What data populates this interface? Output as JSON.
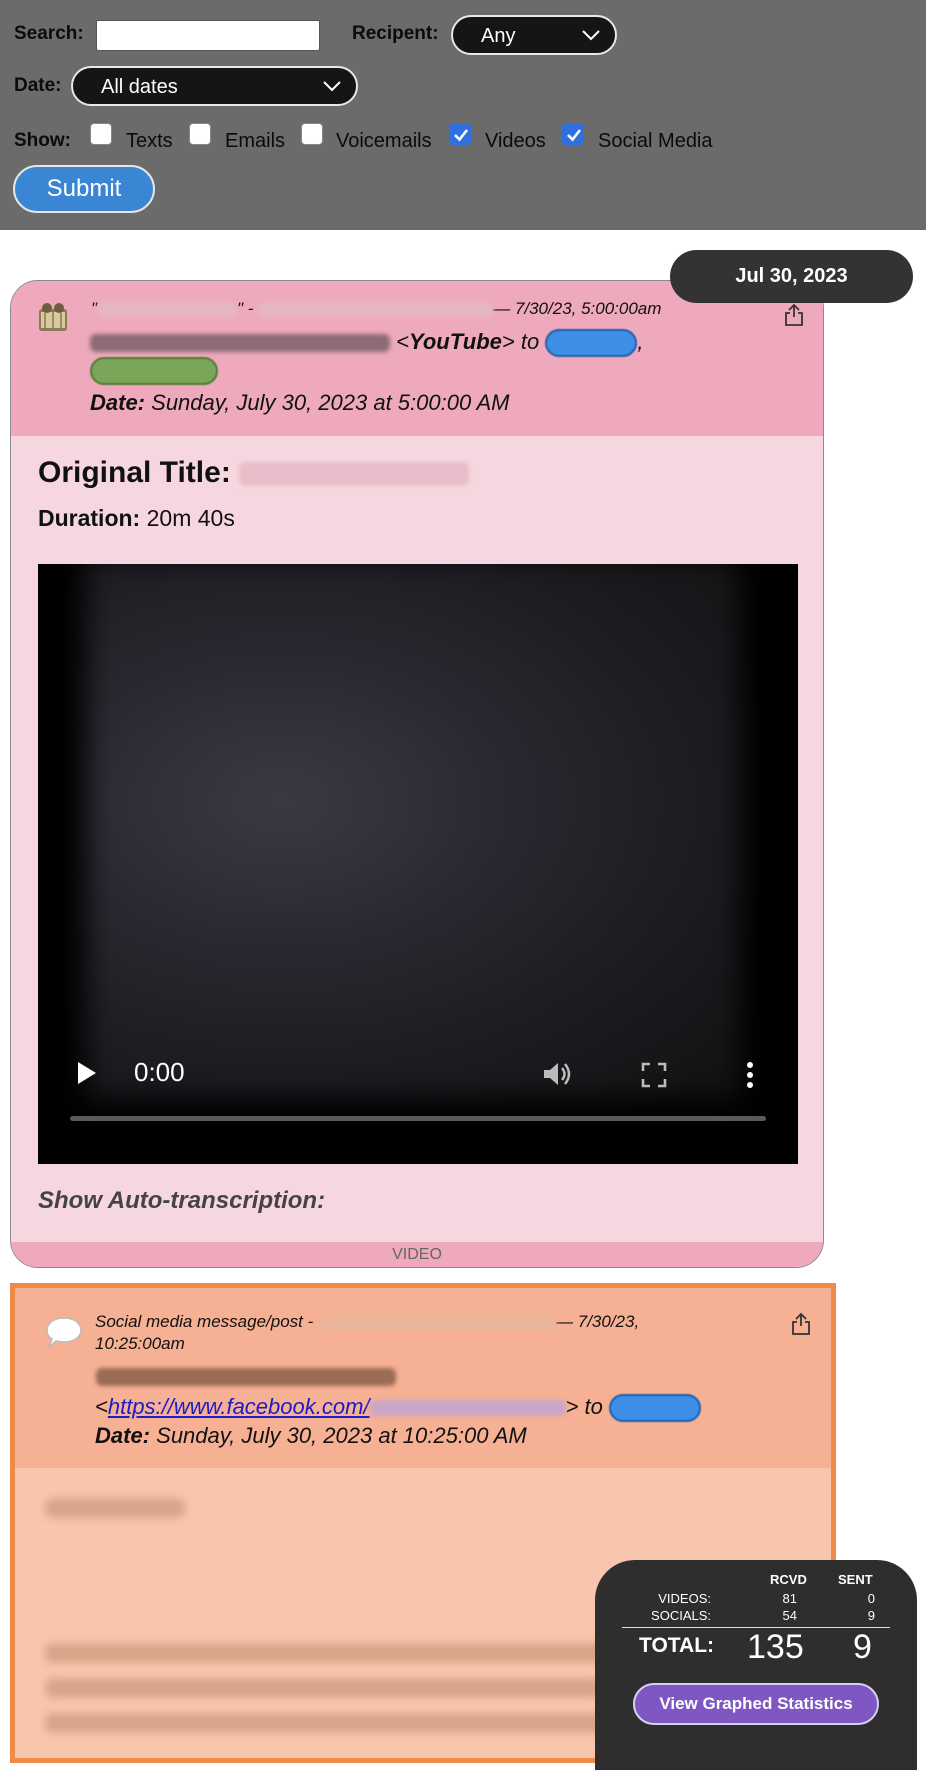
{
  "filters": {
    "search_label": "Search:",
    "search_value": "",
    "recipient_label": "Recipent:",
    "recipient_value": "Any",
    "date_label": "Date:",
    "date_value": "All dates",
    "show_label": "Show:",
    "options": [
      {
        "label": "Texts",
        "checked": false
      },
      {
        "label": "Emails",
        "checked": false
      },
      {
        "label": "Voicemails",
        "checked": false
      },
      {
        "label": "Videos",
        "checked": true
      },
      {
        "label": "Social Media",
        "checked": true
      }
    ],
    "submit_label": "Submit"
  },
  "date_pill": "Jul 30, 2023",
  "video_card": {
    "quote_open": "\"",
    "quote_close": "\" -",
    "timestamp": "— 7/30/23, 5:00:00am",
    "platform_prefix": "<",
    "platform": "YouTube",
    "platform_suffix": "> to",
    "comma": ",",
    "date_label": "Date:",
    "date_value": "Sunday, July 30, 2023 at 5:00:00 AM",
    "original_title_label": "Original Title:",
    "duration_label": "Duration:",
    "duration_value": "20m 40s",
    "video_time": "0:00",
    "transcription_label": "Show Auto-transcription:",
    "footer_label": "VIDEO"
  },
  "social_card": {
    "type_label": "Social media message/post -",
    "timestamp_part1": "— 7/30/23,",
    "timestamp_part2": "10:25:00am",
    "link_prefix": "<",
    "link_text": "https://www.facebook.com/",
    "link_suffix": "> to",
    "date_label": "Date:",
    "date_value": "Sunday, July 30, 2023 at 10:25:00 AM"
  },
  "stats": {
    "col_rcvd": "RCVD",
    "col_sent": "SENT",
    "rows": [
      {
        "label": "VIDEOS:",
        "rcvd": "81",
        "sent": "0"
      },
      {
        "label": "SOCIALS:",
        "rcvd": "54",
        "sent": "9"
      }
    ],
    "total_label": "TOTAL:",
    "total_rcvd": "135",
    "total_sent": "9",
    "button_label": "View Graphed Statistics"
  },
  "colors": {
    "filter_bg": "#6b6b6b",
    "video_card_bg": "#f7d7df",
    "video_header_bg": "#efa9bc",
    "social_border": "#f08a4b",
    "social_bg": "#f8c6ac",
    "submit_bg": "#3b86d4",
    "stats_button_bg": "#7e57c2"
  },
  "icons": [
    "chevron-down-icon",
    "checkmark-icon",
    "film-reel-icon",
    "share-icon",
    "play-icon",
    "volume-icon",
    "fullscreen-icon",
    "more-vert-icon",
    "speech-bubble-icon"
  ]
}
